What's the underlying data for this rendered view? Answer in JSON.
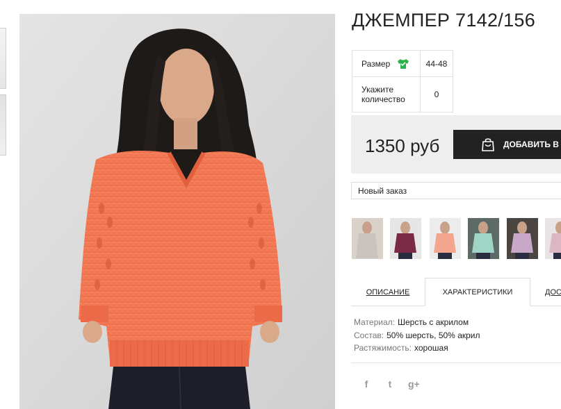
{
  "product": {
    "title": "ДЖЕМПЕР 7142/156"
  },
  "size_table": {
    "size_label": "Размер",
    "size_value": "44-48",
    "qty_label_line1": "Укажите",
    "qty_label_line2": "количество",
    "qty_value": "0"
  },
  "purchase": {
    "price": "1350 руб",
    "add_to_cart_label": "ДОБАВИТЬ В ЗАКАЗ"
  },
  "order_select": {
    "selected": "Новый заказ"
  },
  "tabs": [
    {
      "label": "ОПИСАНИЕ"
    },
    {
      "label": "ХАРАКТЕРИСТИКИ"
    },
    {
      "label": "ДОСТАВКА"
    }
  ],
  "specs": [
    {
      "key": "Материал:",
      "value": "Шерсть с акрилом"
    },
    {
      "key": "Состав:",
      "value": "50% шерсть, 50% акрил"
    },
    {
      "key": "Растяжимость:",
      "value": "хорошая"
    }
  ],
  "social": {
    "facebook": "f",
    "twitter": "t",
    "google_plus": "g+"
  },
  "thumbnails": [
    {
      "icon": "sweater-grey-thumb",
      "color": "#c9c4bd"
    },
    {
      "icon": "sweater-burgundy-thumb",
      "color": "#7a2a44"
    },
    {
      "icon": "sweater-peach-thumb",
      "color": "#f3a58e"
    },
    {
      "icon": "sweater-mint-thumb",
      "color": "#9fd4c6"
    },
    {
      "icon": "sweater-lilac-thumb",
      "color": "#c9a7c9"
    },
    {
      "icon": "sweater-pink-thumb",
      "color": "#dcb7c3"
    }
  ],
  "colors": {
    "sweater": "#f57a55",
    "button_bg": "#222222",
    "price_bg": "#eeeeee",
    "size_icon": "#2bb34a"
  }
}
